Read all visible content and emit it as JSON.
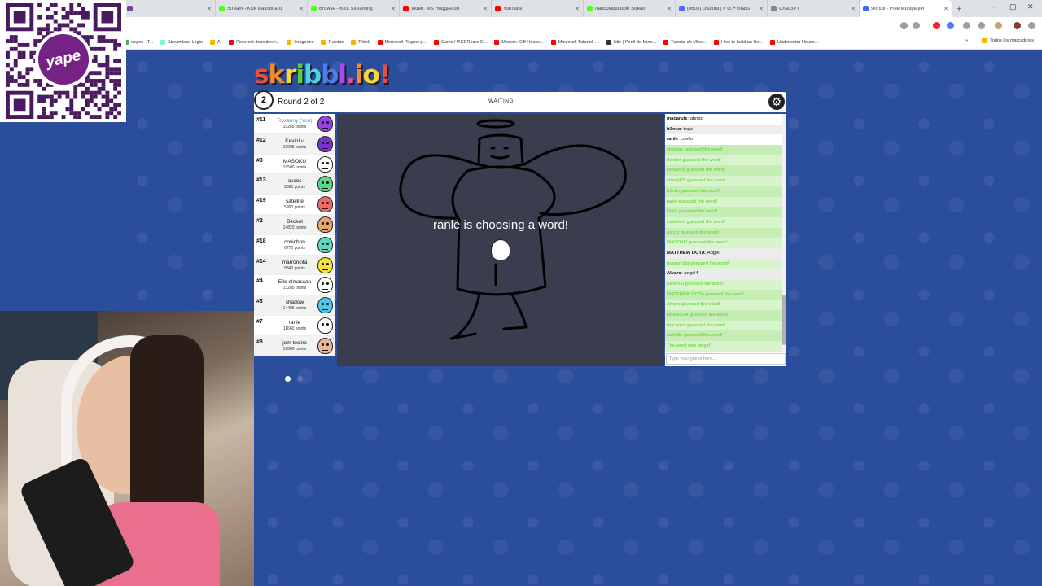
{
  "browser": {
    "tabs": [
      {
        "title": "",
        "color": "#7b3fa0"
      },
      {
        "title": "Stream - Kick Dashboard",
        "color": "#53fc18"
      },
      {
        "title": "Browse - Kick Streaming",
        "color": "#53fc18"
      },
      {
        "title": "Video: Mis Reggaeton",
        "color": "#ff0000"
      },
      {
        "title": "YouTube",
        "color": "#ff0000"
      },
      {
        "title": "francoviddubble Stream",
        "color": "#53fc18"
      },
      {
        "title": "(8603) Discord | # G. • Grass",
        "color": "#5865f2"
      },
      {
        "title": "ChatGPT",
        "color": "#888888"
      },
      {
        "title": "skribbl - Free Multiplayer",
        "color": "#3a6ee8"
      }
    ],
    "window_controls": {
      "min": "–",
      "max": "▢",
      "close": "✕"
    },
    "new_tab": "+",
    "bookmarks": [
      {
        "label": "uegos - T...",
        "color": "#4caf50"
      },
      {
        "label": "Streamlabs Login",
        "color": "#80f5d2"
      },
      {
        "label": "AI",
        "color": "#f4b400"
      },
      {
        "label": "Pinterest descubre i...",
        "color": "#e60023"
      },
      {
        "label": "Imagenes",
        "color": "#f4b400"
      },
      {
        "label": "Ruletas",
        "color": "#f4b400"
      },
      {
        "label": "Tiktok",
        "color": "#f4b400"
      },
      {
        "label": "Minecraft Plugins p...",
        "color": "#ff0000"
      },
      {
        "label": "Como HACER uno C...",
        "color": "#ff0000"
      },
      {
        "label": "Modern Cliff House...",
        "color": "#ff0000"
      },
      {
        "label": "Minecraft Tutorial: ...",
        "color": "#ff0000"
      },
      {
        "label": "kitty | Perfil de Mine...",
        "color": "#333333"
      },
      {
        "label": "Tutorial de Mine...",
        "color": "#ff0000"
      },
      {
        "label": "How to build an Un...",
        "color": "#ff0000"
      },
      {
        "label": "Underwater House...",
        "color": "#ff0000"
      }
    ],
    "bookmarks_more": "»",
    "all_bookmarks": "Todos los marcadores"
  },
  "overlay": {
    "qr_brand": "yape"
  },
  "game": {
    "logo_letters": [
      {
        "ch": "s",
        "color": "#ef4c3c"
      },
      {
        "ch": "k",
        "color": "#f58a2c"
      },
      {
        "ch": "r",
        "color": "#f7d735"
      },
      {
        "ch": "i",
        "color": "#57d13b"
      },
      {
        "ch": "b",
        "color": "#4cd2e0"
      },
      {
        "ch": "b",
        "color": "#4d7ded"
      },
      {
        "ch": "l",
        "color": "#a64ce8"
      },
      {
        "ch": ".",
        "color": "#ef4c9e"
      },
      {
        "ch": "i",
        "color": "#f58a2c"
      },
      {
        "ch": "o",
        "color": "#f7d735"
      },
      {
        "ch": "!",
        "color": "#ef4c3c"
      }
    ],
    "round_number": "2",
    "round_label": "Round 2 of 2",
    "status": "WAITING",
    "canvas_overlay": "ranle is choosing a word!",
    "chat_placeholder": "Type your guess here...",
    "players": [
      {
        "rank": "#11",
        "name": "Roxanny (You)",
        "points": "10265 points",
        "avatar": "#9b3fe8",
        "me": true
      },
      {
        "rank": "#12",
        "name": "KevinLu",
        "points": "10005 points",
        "avatar": "#7a2fd0",
        "me": false
      },
      {
        "rank": "#9",
        "name": "MASOKU",
        "points": "10500 points",
        "avatar": "#ffffff",
        "me": false
      },
      {
        "rank": "#13",
        "name": "ascos",
        "points": "8885 points",
        "avatar": "#58d98a",
        "me": false
      },
      {
        "rank": "#19",
        "name": "satellite",
        "points": "5990 points",
        "avatar": "#f06a6a",
        "me": false
      },
      {
        "rank": "#2",
        "name": "Becket",
        "points": "14820 points",
        "avatar": "#e8a46a",
        "me": false
      },
      {
        "rank": "#18",
        "name": "covichon",
        "points": "6770 points",
        "avatar": "#5ed6c4",
        "me": false
      },
      {
        "rank": "#14",
        "name": "marroncita",
        "points": "8840 points",
        "avatar": "#f5e23a",
        "me": false
      },
      {
        "rank": "#4",
        "name": "Ello elmascap",
        "points": "13285 points",
        "avatar": "#ffffff",
        "me": false
      },
      {
        "rank": "#3",
        "name": "shadow",
        "points": "14485 points",
        "avatar": "#4fc7e8",
        "me": false
      },
      {
        "rank": "#7",
        "name": "ranle",
        "points": "11660 points",
        "avatar": "#ffffff",
        "me": false
      },
      {
        "rank": "#8",
        "name": "jam tocino",
        "points": "10860 points",
        "avatar": "#e8b89a",
        "me": false
      }
    ],
    "chat": [
      {
        "user": "macaruis",
        "text": "abrigo",
        "kind": "msg"
      },
      {
        "user": "Ir3nko",
        "text": "trajo",
        "kind": "msg"
      },
      {
        "user": "ranle",
        "text": "cuello",
        "kind": "msg"
      },
      {
        "user": "",
        "text": "shadow guessed the word!",
        "kind": "guess"
      },
      {
        "user": "",
        "text": "Becket guessed the word!",
        "kind": "guess"
      },
      {
        "user": "",
        "text": "Roxanny guessed the word!",
        "kind": "guess"
      },
      {
        "user": "",
        "text": "charlyUS guessed the word!",
        "kind": "guess"
      },
      {
        "user": "",
        "text": "Ir3nko guessed the word!",
        "kind": "guess"
      },
      {
        "user": "",
        "text": "ranle guessed the word!",
        "kind": "guess"
      },
      {
        "user": "",
        "text": "MAG guessed the word!",
        "kind": "guess"
      },
      {
        "user": "",
        "text": "covichon guessed the word!",
        "kind": "guess"
      },
      {
        "user": "",
        "text": "ascos guessed the word!",
        "kind": "guess"
      },
      {
        "user": "",
        "text": "MASOKU guessed the word!",
        "kind": "guess"
      },
      {
        "user": "MATTHEW DOTA",
        "text": "Abgel",
        "kind": "msg"
      },
      {
        "user": "",
        "text": "marroncita guessed the word!",
        "kind": "guess"
      },
      {
        "user": "Alvaro",
        "text": "angel4",
        "kind": "msg"
      },
      {
        "user": "",
        "text": "KevinLu guessed the word!",
        "kind": "guess"
      },
      {
        "user": "",
        "text": "MATTHEW DOTA guessed the word!",
        "kind": "guess"
      },
      {
        "user": "",
        "text": "Alvaro guessed the word!",
        "kind": "guess"
      },
      {
        "user": "",
        "text": "RoMeO14 guessed the word!",
        "kind": "guess"
      },
      {
        "user": "",
        "text": "macaruis guessed the word!",
        "kind": "guess"
      },
      {
        "user": "",
        "text": "satellite guessed the word!",
        "kind": "guess"
      },
      {
        "user": "",
        "text": "The word was 'angel'",
        "kind": "word"
      }
    ]
  }
}
